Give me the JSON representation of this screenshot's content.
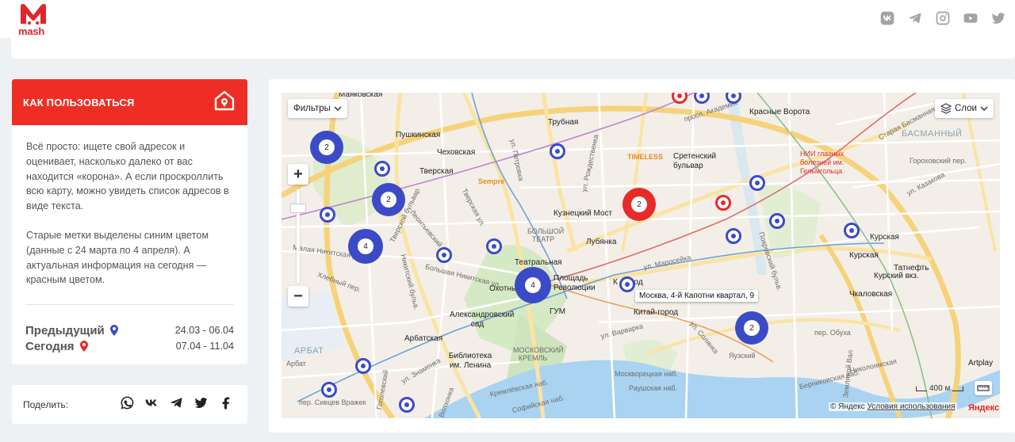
{
  "header": {
    "logo_text": "mash",
    "socials": [
      {
        "icon": "vk-icon"
      },
      {
        "icon": "telegram-icon"
      },
      {
        "icon": "instagram-icon"
      },
      {
        "icon": "youtube-icon"
      },
      {
        "icon": "twitter-icon"
      }
    ]
  },
  "howto": {
    "title": "КАК ПОЛЬЗОВАТЬСЯ",
    "paragraph1": "Всё просто: ищете свой адресок и оценивает, насколько далеко от вас находится «корона». А если проскроллить всю карту, можно увидеть список адресов в виде текста.",
    "paragraph2": "Старые метки выделены синим цветом (данные с 24 марта по 4 апреля). А актуальная информация на сегодня — красным цветом.",
    "previous_label": "Предыдущий",
    "previous_dates": "24.03 - 06.04",
    "today_label": "Сегодня",
    "today_dates": "07.04 - 11.04",
    "colors": {
      "previous": "#3b4bc8",
      "today": "#e82a2a",
      "accent": "#ee2e24"
    }
  },
  "share": {
    "label": "Поделить:",
    "icons": [
      "whatsapp-icon",
      "vk-icon",
      "telegram-icon",
      "twitter-icon",
      "facebook-icon"
    ]
  },
  "map": {
    "filters_label": "Фильтры",
    "layers_label": "Слои",
    "zoom_in": "+",
    "zoom_out": "−",
    "tooltip": "Москва, 4-й Капотни квартал, 9",
    "scale": "400 м",
    "copyright": "© Яндекс",
    "terms": "Условия использования",
    "brand": "Яндекс",
    "clusters": [
      "2",
      "2",
      "4",
      "4",
      "2",
      "2"
    ],
    "labels": {
      "mayakovskaya": "Маяковская",
      "pushkinskaya": "Пушкинская",
      "chekhovskaya": "Чеховская",
      "tverskaya": "Тверская",
      "trubnaya": "Трубная",
      "krasnye_vorota": "Красные Ворота",
      "timeless": "TIMELESS",
      "sretensky": "Сретенский бульвар",
      "sempre": "Sempre",
      "kuznetsky": "Кузнецкий Мост",
      "bolshoi": "БОЛЬШОЙ ТЕАТР",
      "lubyanka": "Лубянка",
      "teatralnaya": "Театральная",
      "ploshchad": "Площадь Революции",
      "okhotny": "Охотный",
      "kitay1": "К   -город",
      "kitay2": "Китай-город",
      "gum": "ГУМ",
      "aleksandrovsky": "Александровский сад",
      "arbatskaya": "Арбатская",
      "biblioteka": "Библиотека им. Ленина",
      "kreml": "МОСКОВСКИЙ КРЕМЛЬ",
      "arbat": "АРБАТ",
      "basmanny": "БАСМАННЫЙ",
      "kurskaya1": "Курская",
      "kurskaya2": "Курская",
      "kursky_vokz": "Курский вкз.",
      "chkalovskaya": "Чкаловская",
      "tatneft": "Татнефть",
      "nii": "НИИ глазных болезней им. Гельмгольца",
      "artplay": "Artplay",
      "yauzsky": "Яузский",
      "kremlevskaya": "Кремлёвская наб.",
      "raushskaya": "Раушская наб.",
      "moskvoretskaya": "Москворецкая наб.",
      "nikolo": "Николоямская",
      "bernikovskaya": "Берниковская наб.",
      "sofiyskaya": "Софийская наб.",
      "maroseyka": "ул. Маросейка",
      "varvarka": "ул. Варварка",
      "gorokhovsky": "Гороховский пер.",
      "bolshaya_nikitskaya": "Большая Никитская ул.",
      "malaya_nikitskaya": "Малая Никитская ул.",
      "tverskoy_bulvar": "Тверской бульвар",
      "tverskaya_ul": "Тверская ул.",
      "petrovka": "ул. Петровка",
      "rozhdestvenka": "ул. Рождественка",
      "prosp_akad": "просп. Академик",
      "staraya_basm": "Старая Басманная ул.",
      "pokrovsky": "Покровский бульв.",
      "solyanka": "ул. Солянка",
      "znamenka": "ул. Знаменка",
      "gogolevsky": "Гоголевский",
      "volkhonka": "Волхонка",
      "sivtsev": "пер. Сивцев Вражек",
      "arbat_ul": "Арбат",
      "kazakova": "ул. Казакова",
      "zemlyanoy": "Земляной Вал",
      "obukha": "пер. Обуха",
      "nikitsky": "Никитский бульв.",
      "khlebny": "Хлебный пер.",
      "leontievsky": "Леонтьевский пер."
    }
  }
}
